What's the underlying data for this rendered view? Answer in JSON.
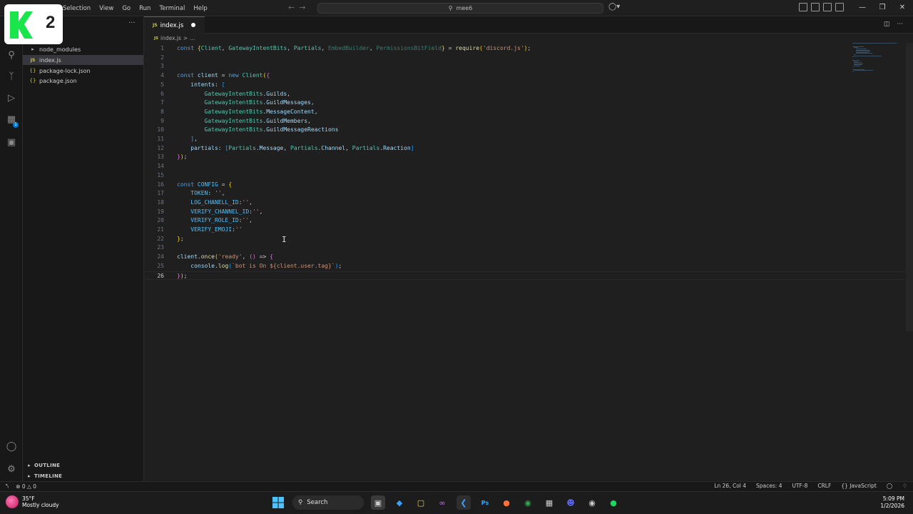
{
  "menu": [
    "Selection",
    "View",
    "Go",
    "Run",
    "Terminal",
    "Help"
  ],
  "command_center": {
    "label": "mee6"
  },
  "logo": {
    "number": "2"
  },
  "explorer": {
    "items": [
      {
        "name": "node_modules",
        "type": "folder"
      },
      {
        "name": "index.js",
        "type": "js",
        "active": true
      },
      {
        "name": "package-lock.json",
        "type": "json"
      },
      {
        "name": "package.json",
        "type": "json"
      }
    ],
    "outline": "OUTLINE",
    "timeline": "TIMELINE"
  },
  "tab": {
    "label": "index.js",
    "dirty": true
  },
  "breadcrumb": {
    "file": "index.js",
    "sep": ">",
    "more": "..."
  },
  "activity_badge": "1",
  "code": [
    "const {Client, GatewayIntentBits, Partials, EmbedBuilder, PermissionsBitField} = require('discord.js');",
    "",
    "",
    "const client = new Client({",
    "    intents: [",
    "        GatewayIntentBits.Guilds,",
    "        GatewayIntentBits.GuildMessages,",
    "        GatewayIntentBits.MessageContent,",
    "        GatewayIntentBits.GuildMembers,",
    "        GatewayIntentBits.GuildMessageReactions",
    "    ],",
    "    partials: [Partials.Message, Partials.Channel, Partials.Reaction]",
    "});",
    "",
    "",
    "const CONFIG = {",
    "    TOKEN: '',",
    "    LOG_CHANELL_ID:'',",
    "    VERIFY_CHANNEL_ID:'',",
    "    VERIFY_ROLE_ID:'',",
    "    VERIFY_EMOJI:''",
    "};",
    "",
    "client.once('ready', () => {",
    "    console.log(`bot is On ${client.user.tag}`);",
    "});"
  ],
  "current_line": 26,
  "statusbar": {
    "errors": "0",
    "warnings": "0",
    "position": "Ln 26, Col 4",
    "spaces": "Spaces: 4",
    "encoding": "UTF-8",
    "eol": "CRLF",
    "language": "JavaScript"
  },
  "taskbar": {
    "temperature": "35°F",
    "weather": "Mostly cloudy",
    "search": "Search",
    "time": "5:09 PM",
    "date": "1/2/2026"
  }
}
